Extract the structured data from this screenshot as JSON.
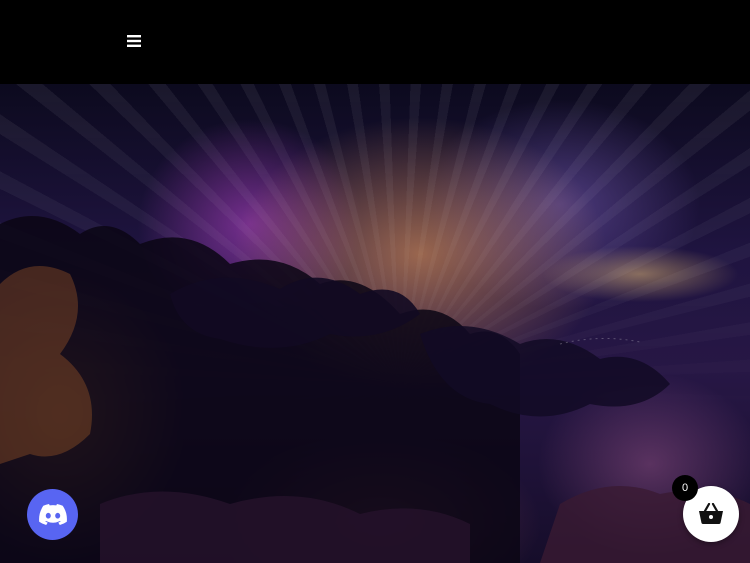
{
  "header": {
    "menu_icon": "hamburger-menu-icon"
  },
  "hero": {
    "image_kind": "sky with clouds and light rays"
  },
  "floating": {
    "discord_icon": "discord-icon",
    "cart_icon": "basket-icon",
    "cart_count": "0"
  },
  "colors": {
    "background": "#000000",
    "discord_brand": "#5865f2",
    "cart_button": "#ffffff",
    "badge": "#000000"
  }
}
